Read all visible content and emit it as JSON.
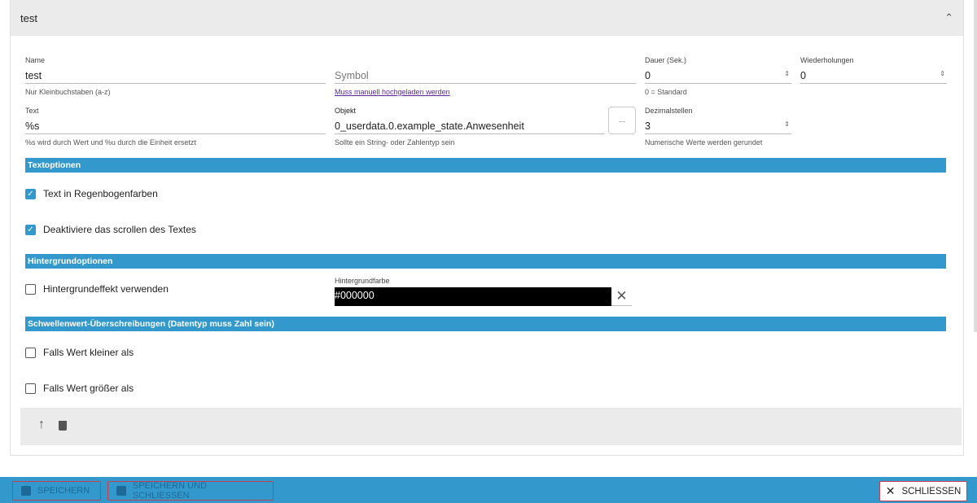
{
  "header": {
    "title": "test"
  },
  "fields": {
    "name": {
      "label": "Name",
      "value": "test",
      "help": "Nur Kleinbuchstaben (a-z)"
    },
    "symbol": {
      "placeholder": "Symbol",
      "help": "Muss manuell hochgeladen werden"
    },
    "duration": {
      "label": "Dauer (Sek.)",
      "value": "0",
      "help": "0 = Standard"
    },
    "repeats": {
      "label": "Wiederholungen",
      "value": "0"
    },
    "text": {
      "label": "Text",
      "value": "%s",
      "help": "%s wird durch Wert und %u durch die Einheit ersetzt"
    },
    "object": {
      "label": "Objekt",
      "value": "0_userdata.0.example_state.Anwesenheit",
      "help": "Sollte ein String- oder Zahlentyp sein",
      "button": "..."
    },
    "decimals": {
      "label": "Dezimalstellen",
      "value": "3",
      "help": "Numerische Werte werden gerundet"
    }
  },
  "sections": {
    "text": "Textoptionen",
    "background": "Hintergrundoptionen",
    "threshold": "Schwellenwert-Überschreibungen (Datentyp muss Zahl sein)"
  },
  "checkboxes": {
    "rainbow": "Text in Regenbogenfarben",
    "noscroll": "Deaktiviere das scrollen des Textes",
    "bgeffect": "Hintergrundeffekt verwenden",
    "lower": "Falls Wert kleiner als",
    "greater": "Falls Wert größer als"
  },
  "bgcolor": {
    "label": "Hintergrundfarbe",
    "value": "#000000"
  },
  "footer": {
    "save": "SPEICHERN",
    "save_close": "SPEICHERN UND SCHLIESSEN",
    "close": "SCHLIESSEN"
  }
}
